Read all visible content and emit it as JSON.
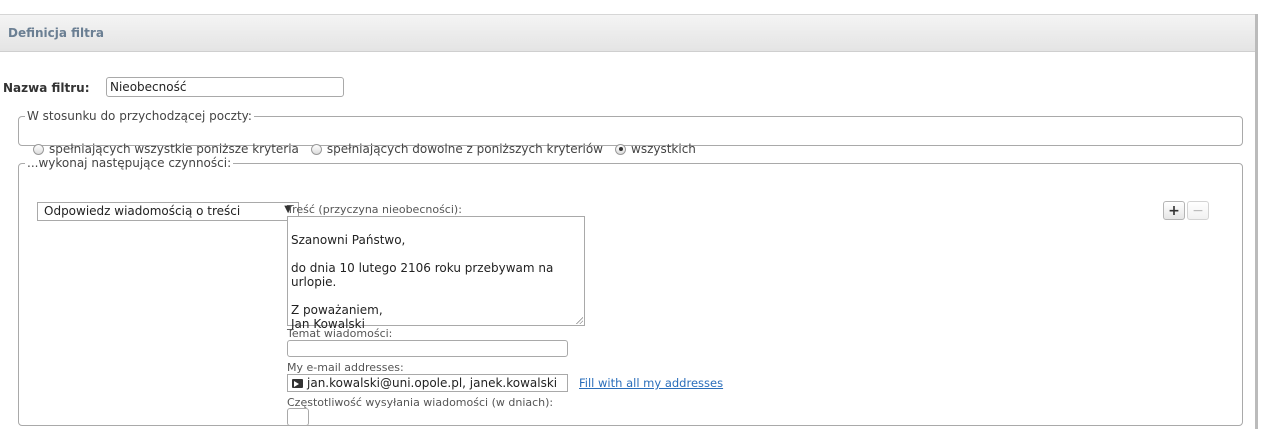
{
  "header": {
    "title": "Definicja filtra"
  },
  "filter_name": {
    "label": "Nazwa filtru:",
    "value": "Nieobecność"
  },
  "incoming": {
    "legend": "W stosunku do przychodzącej poczty:",
    "options": [
      {
        "label": "spełniających wszystkie poniższe kryteria",
        "selected": false
      },
      {
        "label": "spełniających dowolne z poniższych kryteriów",
        "selected": false
      },
      {
        "label": "wszystkich",
        "selected": true
      }
    ]
  },
  "actions": {
    "legend": "...wykonaj następujące czynności:",
    "action_select": {
      "value": "Odpowiedz wiadomością o treści",
      "arrow": "▼"
    },
    "body_label": "Treść (przyczyna nieobecności):",
    "body_text": "Szanowni Państwo,\n\ndo dnia 10 lutego 2106 roku przebywam na urlopie.\n\nZ poważaniem,\nJan Kowalski",
    "subject_label": "Temat wiadomości:",
    "subject_value": "",
    "emails_label": "My e-mail addresses:",
    "emails_value": "jan.kowalski@uni.opole.pl, janek.kowalski",
    "fill_link": "Fill with all my addresses",
    "frequency_label": "Częstotliwość wysyłania wiadomości (w dniach):",
    "frequency_value": "",
    "add_button": "+",
    "remove_button": "−"
  }
}
